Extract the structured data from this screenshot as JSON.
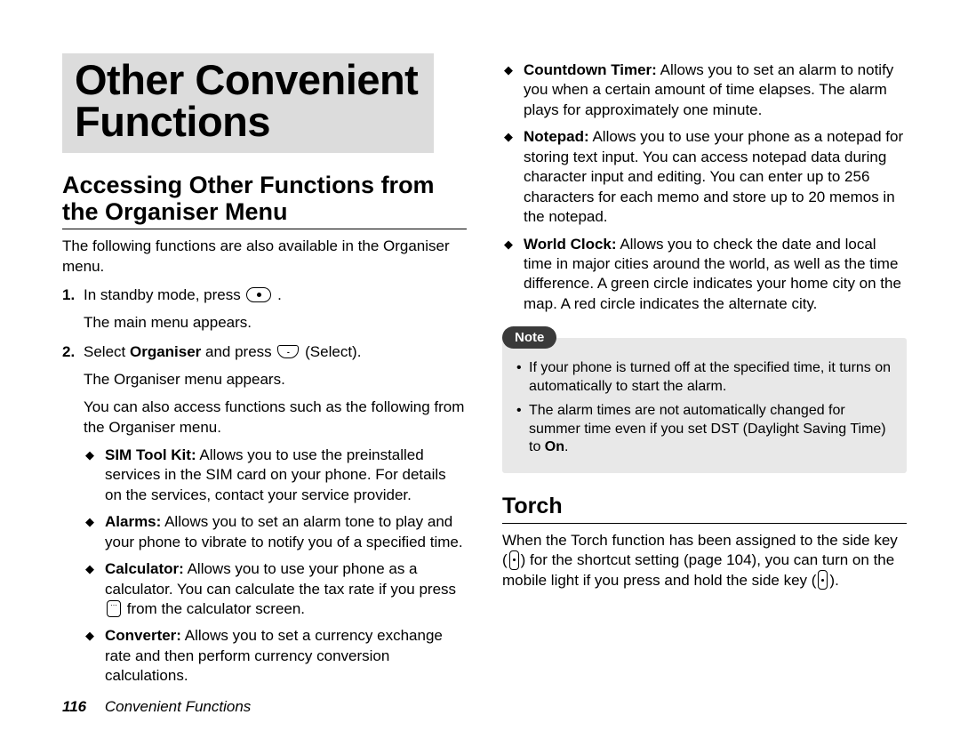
{
  "chapter_title_line1": "Other Convenient",
  "chapter_title_line2": "Functions",
  "section_accessing": "Accessing Other Functions from the Organiser Menu",
  "intro": "The following functions are also available in the Organiser menu.",
  "step1": {
    "num": "1.",
    "pre": "In standby mode, press ",
    "post": ".",
    "sub": "The main menu appears."
  },
  "step2": {
    "num": "2.",
    "pre": "Select ",
    "bold": "Organiser",
    "mid": " and press ",
    "post": " (Select).",
    "sub1": "The Organiser menu appears.",
    "sub2": "You can also access functions such as the following from the Organiser menu."
  },
  "features_left": [
    {
      "name": "SIM Tool Kit:",
      "desc": " Allows you to use the preinstalled services in the SIM card on your phone. For details on the services, contact your service provider."
    },
    {
      "name": "Alarms:",
      "desc": " Allows you to set an alarm tone to play and your phone to vibrate to notify you of a specified time."
    },
    {
      "name": "Calculator:",
      "desc_pre": " Allows you to use your phone as a calculator. You can calculate the tax rate if you press ",
      "desc_post": " from the calculator screen."
    },
    {
      "name": "Converter:",
      "desc": " Allows you to set a currency exchange rate and then perform currency conversion calculations."
    }
  ],
  "features_right": [
    {
      "name": "Countdown Timer:",
      "desc": " Allows you to set an alarm to notify you when a certain amount of time elapses. The alarm plays for approximately one minute."
    },
    {
      "name": "Notepad:",
      "desc": " Allows you to use your phone as a notepad for storing text input. You can access notepad data during character input and editing. You can enter up to 256 characters for each memo and store up to 20 memos in the notepad."
    },
    {
      "name": "World Clock:",
      "desc": " Allows you to check the date and local time in major cities around the world, as well as the time difference. A green circle indicates your home city  on the map. A red circle indicates the alternate city."
    }
  ],
  "note_label": "Note",
  "note_items": [
    "If your phone is turned off at the specified time, it turns on automatically to start the alarm.",
    {
      "pre": "The alarm times are not automatically changed for summer time even if you set DST (Daylight Saving Time) to ",
      "bold": "On",
      "post": "."
    }
  ],
  "torch_title": "Torch",
  "torch_body": {
    "pre": "When the Torch function has been assigned to the side key (",
    "mid1": ") for the shortcut setting (page 104), you can turn on the mobile light if you press and hold the side key (",
    "post": ")."
  },
  "page_number": "116",
  "footer_title": "Convenient Functions"
}
